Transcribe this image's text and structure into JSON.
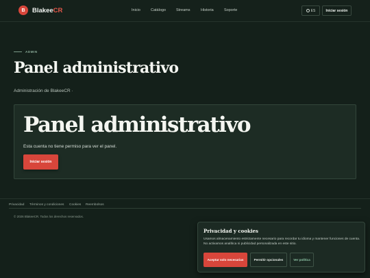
{
  "header": {
    "logo_letter": "B",
    "brand_main": "Blakee",
    "brand_accent": "CR",
    "nav": [
      "Inicio",
      "Catálogo",
      "Streams",
      "Historia",
      "Soporte"
    ],
    "language": "ES",
    "login_label": "Iniciar sesión"
  },
  "hero": {
    "eyebrow": "ADMIN",
    "title": "Panel administrativo",
    "subtitle": "Administración de BlakeeCR ·"
  },
  "card": {
    "title": "Panel administrativo",
    "text": "Esta cuenta no tiene permiso para ver el panel.",
    "button_label": "Iniciar sesión"
  },
  "footer": {
    "links": [
      "Privacidad",
      "Términos y condiciones",
      "Cookies",
      "Reembolsos"
    ],
    "copyright": "© 2026 BlakeeCR. Todos los derechos reservados."
  },
  "cookie_banner": {
    "title": "Privacidad y cookies",
    "text": "Usamos almacenamiento estrictamente necesario para recordar tu idioma y mantener funciones de cuenta. No activamos analítica ni publicidad personalizada en este sitio.",
    "accept_label": "Aceptar solo necesarias",
    "optional_label": "Permitir opcionales",
    "policy_label": "Ver política"
  },
  "colors": {
    "background": "#14201a",
    "accent": "#d8463b",
    "card": "#1d2c24"
  }
}
